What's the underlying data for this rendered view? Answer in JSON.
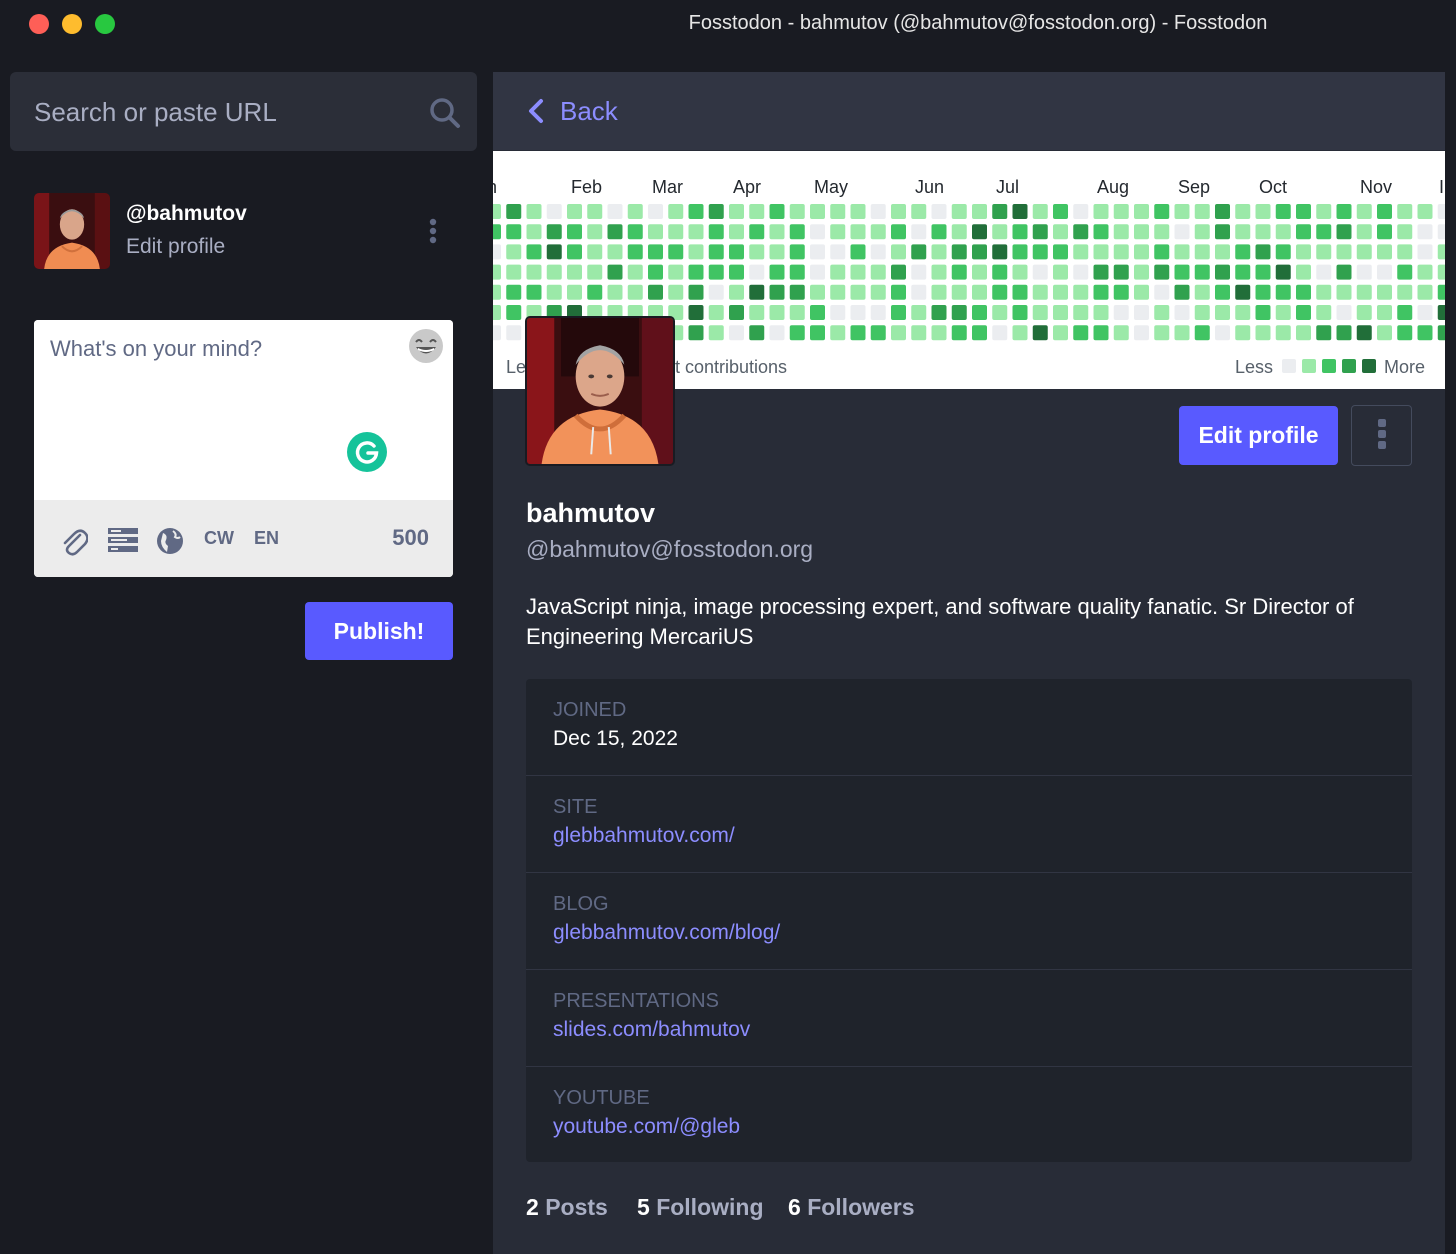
{
  "window": {
    "title": "Fosstodon - bahmutov (@bahmutov@fosstodon.org) - Fosstodon"
  },
  "search": {
    "placeholder": "Search or paste URL",
    "icon": "search-icon"
  },
  "current_user": {
    "handle": "@bahmutov",
    "edit_label": "Edit profile"
  },
  "compose": {
    "placeholder": "What's on your mind?",
    "tools": {
      "cw": "CW",
      "lang": "EN"
    },
    "char_count": "500",
    "publish_label": "Publish!"
  },
  "nav": {
    "back_label": "Back"
  },
  "contributions": {
    "months": [
      "n",
      "Feb",
      "Mar",
      "Apr",
      "May",
      "Jun",
      "Jul",
      "Aug",
      "Sep",
      "Oct",
      "Nov",
      "I"
    ],
    "caption_left": "Le",
    "caption_right": "t contributions",
    "less_label": "Less",
    "more_label": "More",
    "colors": [
      "#ebedf0",
      "#9be9a8",
      "#40c463",
      "#30a14e",
      "#216e39"
    ]
  },
  "profile": {
    "edit_label": "Edit profile",
    "display_name": "bahmutov",
    "acct": "@bahmutov@fosstodon.org",
    "bio": "JavaScript ninja, image processing expert, and software quality fanatic. Sr Director of Engineering MercariUS",
    "fields": [
      {
        "name": "JOINED",
        "value": "Dec 15, 2022",
        "link": false
      },
      {
        "name": "SITE",
        "value": "glebbahmutov.com/",
        "link": true
      },
      {
        "name": "BLOG",
        "value": "glebbahmutov.com/blog/",
        "link": true
      },
      {
        "name": "PRESENTATIONS",
        "value": "slides.com/bahmutov",
        "link": true
      },
      {
        "name": "YOUTUBE",
        "value": "youtube.com/@gleb",
        "link": true
      }
    ],
    "stats": {
      "posts_count": "2",
      "posts_label": "Posts",
      "following_count": "5",
      "following_label": "Following",
      "followers_count": "6",
      "followers_label": "Followers"
    }
  },
  "colors": {
    "accent": "#595aff",
    "link": "#8c8dff",
    "bg": "#191b22",
    "panel": "#282c37"
  }
}
